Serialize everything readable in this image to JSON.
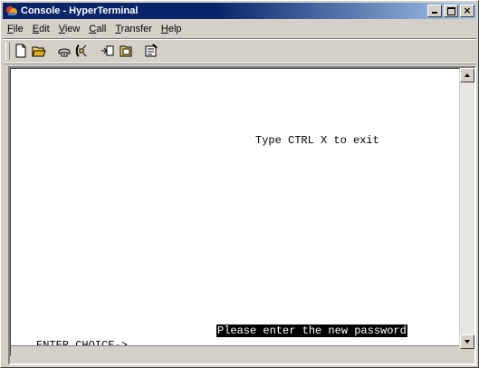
{
  "window": {
    "title": "Console - HyperTerminal",
    "title_bar_color": "#0a246a"
  },
  "menubar": {
    "items": [
      {
        "key": "F",
        "rest": "ile"
      },
      {
        "key": "E",
        "rest": "dit",
        "prefix": ""
      },
      {
        "key": "V",
        "rest": "iew"
      },
      {
        "key": "C",
        "rest": "all"
      },
      {
        "key": "T",
        "rest": "ransfer"
      },
      {
        "key": "H",
        "rest": "elp"
      }
    ]
  },
  "toolbar": {
    "buttons": [
      "new-icon",
      "open-icon",
      "connect-icon",
      "disconnect-icon",
      "send-icon",
      "receive-icon",
      "properties-icon"
    ]
  },
  "terminal": {
    "line_exit": "Type CTRL X to exit",
    "line_prompt_password": "Please enter the new password",
    "line_enter_choice": "ENTER CHOICE->"
  }
}
